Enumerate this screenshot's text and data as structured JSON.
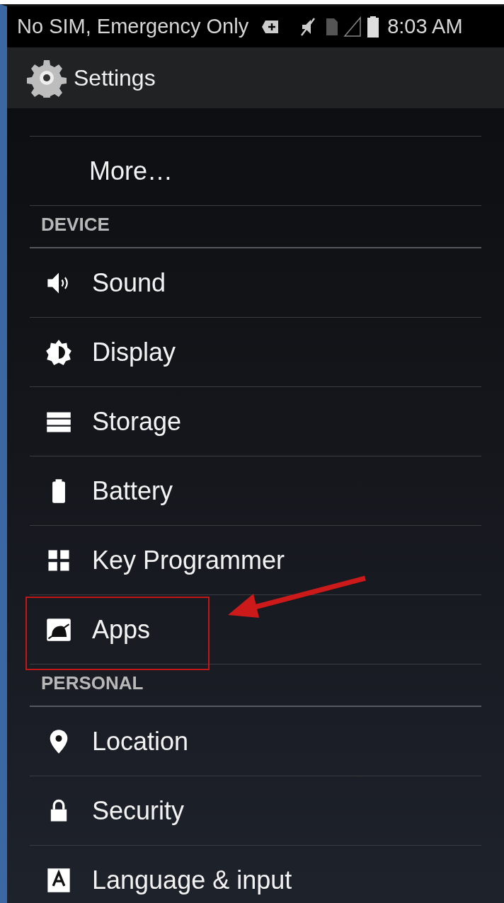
{
  "status_bar": {
    "carrier": "No SIM, Emergency Only",
    "time": "8:03 AM"
  },
  "header": {
    "title": "Settings"
  },
  "list": [
    {
      "kind": "item",
      "label": "More…",
      "annotated": false
    },
    {
      "kind": "section",
      "label": "DEVICE"
    },
    {
      "kind": "item",
      "label": "Sound",
      "annotated": false
    },
    {
      "kind": "item",
      "label": "Display",
      "annotated": false
    },
    {
      "kind": "item",
      "label": "Storage",
      "annotated": false
    },
    {
      "kind": "item",
      "label": "Battery",
      "annotated": false
    },
    {
      "kind": "item",
      "label": "Key Programmer",
      "annotated": false
    },
    {
      "kind": "item",
      "label": "Apps",
      "annotated": true
    },
    {
      "kind": "section",
      "label": "PERSONAL"
    },
    {
      "kind": "item",
      "label": "Location",
      "annotated": false
    },
    {
      "kind": "item",
      "label": "Security",
      "annotated": false
    },
    {
      "kind": "item",
      "label": "Language & input",
      "annotated": false
    }
  ]
}
